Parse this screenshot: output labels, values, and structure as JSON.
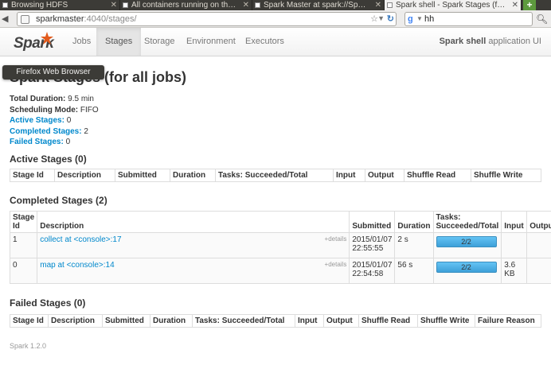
{
  "browser": {
    "tabs": [
      {
        "label": "Browsing HDFS",
        "active": false
      },
      {
        "label": "All containers running on th…",
        "active": false
      },
      {
        "label": "Spark Master at spark://Sp…",
        "active": false
      },
      {
        "label": "Spark shell - Spark Stages (f…",
        "active": true
      }
    ],
    "url_host": "sparkmaster",
    "url_path": ":4040/stages/",
    "search_value": "hh",
    "tooltip": "Firefox Web Browser"
  },
  "header": {
    "logo_text": "Spark",
    "nav": [
      {
        "label": "Jobs",
        "active": false
      },
      {
        "label": "Stages",
        "active": true
      },
      {
        "label": "Storage",
        "active": false
      },
      {
        "label": "Environment",
        "active": false
      },
      {
        "label": "Executors",
        "active": false
      }
    ],
    "app_name_bold": "Spark shell",
    "app_name_suffix": " application UI"
  },
  "page": {
    "title": "Spark Stages (for all jobs)",
    "summary": {
      "total_duration_label": "Total Duration:",
      "total_duration": " 9.5 min",
      "scheduling_mode_label": "Scheduling Mode:",
      "scheduling_mode": " FIFO",
      "active_stages_label": "Active Stages:",
      "active_stages": " 0",
      "completed_stages_label": "Completed Stages:",
      "completed_stages": " 2",
      "failed_stages_label": "Failed Stages:",
      "failed_stages": " 0"
    }
  },
  "active_section": {
    "title": "Active Stages (0)",
    "headers": [
      "Stage Id",
      "Description",
      "Submitted",
      "Duration",
      "Tasks: Succeeded/Total",
      "Input",
      "Output",
      "Shuffle Read",
      "Shuffle Write"
    ]
  },
  "completed_section": {
    "title": "Completed Stages (2)",
    "headers": [
      "Stage Id",
      "Description",
      "Submitted",
      "Duration",
      "Tasks: Succeeded/Total",
      "Input",
      "Output"
    ],
    "rows": [
      {
        "id": "1",
        "desc": "collect at <console>:17",
        "details": "+details",
        "submitted": "2015/01/07 22:55:55",
        "duration": "2 s",
        "tasks": "2/2",
        "tasks_fraction": 1.0,
        "input": "",
        "output": ""
      },
      {
        "id": "0",
        "desc": "map at <console>:14",
        "details": "+details",
        "submitted": "2015/01/07 22:54:58",
        "duration": "56 s",
        "tasks": "2/2",
        "tasks_fraction": 1.0,
        "input": "3.6 KB",
        "output": ""
      }
    ]
  },
  "failed_section": {
    "title": "Failed Stages (0)",
    "headers": [
      "Stage Id",
      "Description",
      "Submitted",
      "Duration",
      "Tasks: Succeeded/Total",
      "Input",
      "Output",
      "Shuffle Read",
      "Shuffle Write",
      "Failure Reason"
    ]
  },
  "footer": "Spark 1.2.0",
  "colors": {
    "link": "#0088cc",
    "progress": "#4fb3ea"
  }
}
